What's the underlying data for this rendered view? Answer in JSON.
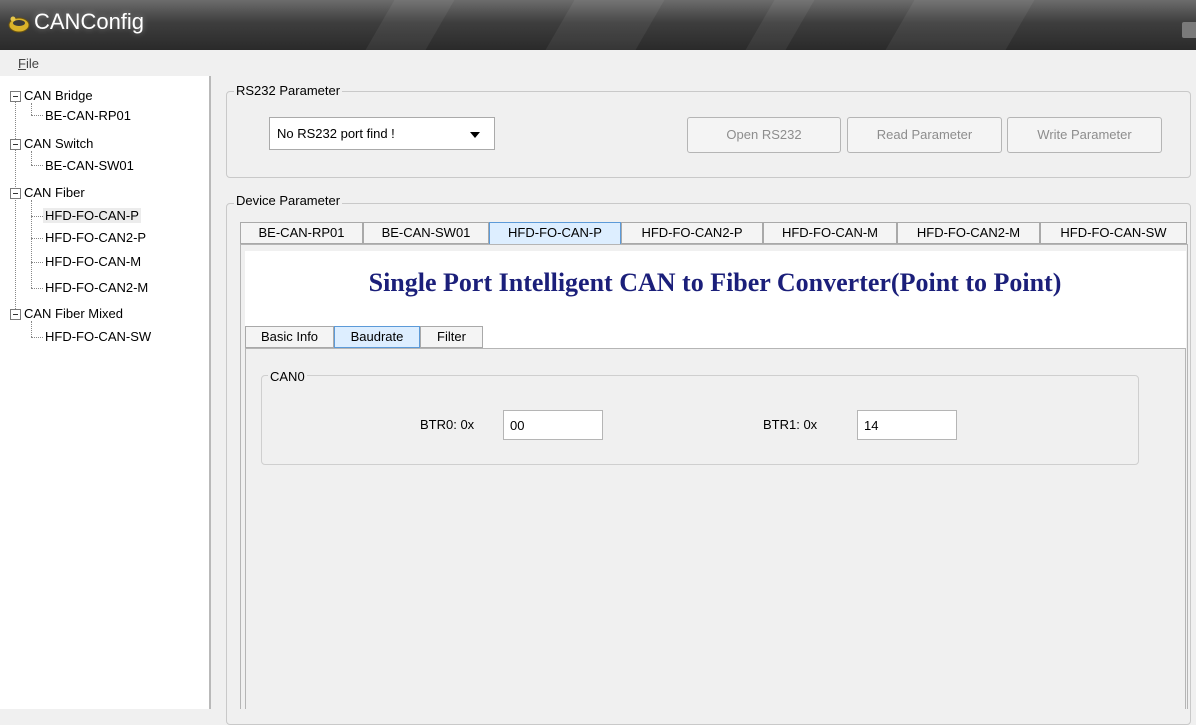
{
  "window": {
    "title": "CANConfig",
    "icon": "app-icon"
  },
  "menu": {
    "file": "File"
  },
  "tree": [
    {
      "label": "CAN Bridge",
      "children": [
        "BE-CAN-RP01"
      ]
    },
    {
      "label": "CAN Switch",
      "children": [
        "BE-CAN-SW01"
      ]
    },
    {
      "label": "CAN Fiber",
      "children": [
        "HFD-FO-CAN-P",
        "HFD-FO-CAN2-P",
        "HFD-FO-CAN-M",
        "HFD-FO-CAN2-M"
      ]
    },
    {
      "label": "CAN Fiber Mixed",
      "children": [
        "HFD-FO-CAN-SW"
      ]
    }
  ],
  "rs232": {
    "group_label": "RS232 Parameter",
    "port_value": "No RS232 port find !",
    "open_button": "Open RS232",
    "read_button": "Read Parameter",
    "write_button": "Write Parameter"
  },
  "device": {
    "group_label": "Device Parameter",
    "tabs": [
      "BE-CAN-RP01",
      "BE-CAN-SW01",
      "HFD-FO-CAN-P",
      "HFD-FO-CAN2-P",
      "HFD-FO-CAN-M",
      "HFD-FO-CAN2-M",
      "HFD-FO-CAN-SW"
    ],
    "active_tab": "HFD-FO-CAN-P",
    "heading": "Single Port Intelligent CAN to Fiber Converter(Point to Point)",
    "sub_tabs": [
      "Basic Info",
      "Baudrate",
      "Filter"
    ],
    "active_sub_tab": "Baudrate",
    "can0": {
      "group_label": "CAN0",
      "btr0_label": "BTR0: 0x",
      "btr0_value": "00",
      "btr1_label": "BTR1: 0x",
      "btr1_value": "14"
    }
  },
  "colors": {
    "heading": "#1b1f7a",
    "active_tab": "#ddeeff",
    "active_border": "#5c9ad8"
  }
}
